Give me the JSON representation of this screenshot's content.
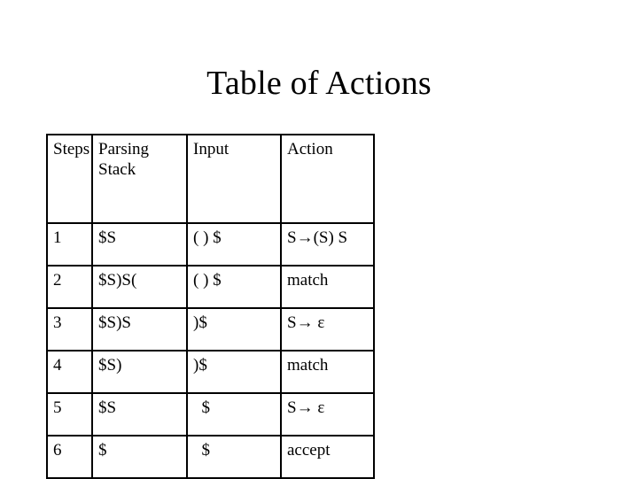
{
  "slide": {
    "title": "Table of Actions"
  },
  "table": {
    "name": "table-of-actions",
    "columns": [
      {
        "key": "steps",
        "label": "Steps"
      },
      {
        "key": "stack",
        "label": "Parsing Stack"
      },
      {
        "key": "input",
        "label": "Input"
      },
      {
        "key": "action",
        "label": "Action"
      }
    ],
    "rows": [
      {
        "steps": "1",
        "stack": "$S",
        "input": "( ) $",
        "action": "S→(S) S",
        "small": false
      },
      {
        "steps": "2",
        "stack": "$S)S(",
        "input": "( ) $",
        "action": "match",
        "small": false
      },
      {
        "steps": "3",
        "stack": "$S)S",
        "input": ")$",
        "action": "S→ ε",
        "small": true
      },
      {
        "steps": "4",
        "stack": "$S)",
        "input": ")$",
        "action": "match",
        "small": false
      },
      {
        "steps": "5",
        "stack": "$S",
        "input": "  $",
        "action": "S→ ε",
        "small": true
      },
      {
        "steps": "6",
        "stack": "$",
        "input": "  $",
        "action": "accept",
        "small": false
      }
    ]
  },
  "colors": {
    "background": "#ffffff",
    "text": "#000000",
    "border": "#000000"
  }
}
